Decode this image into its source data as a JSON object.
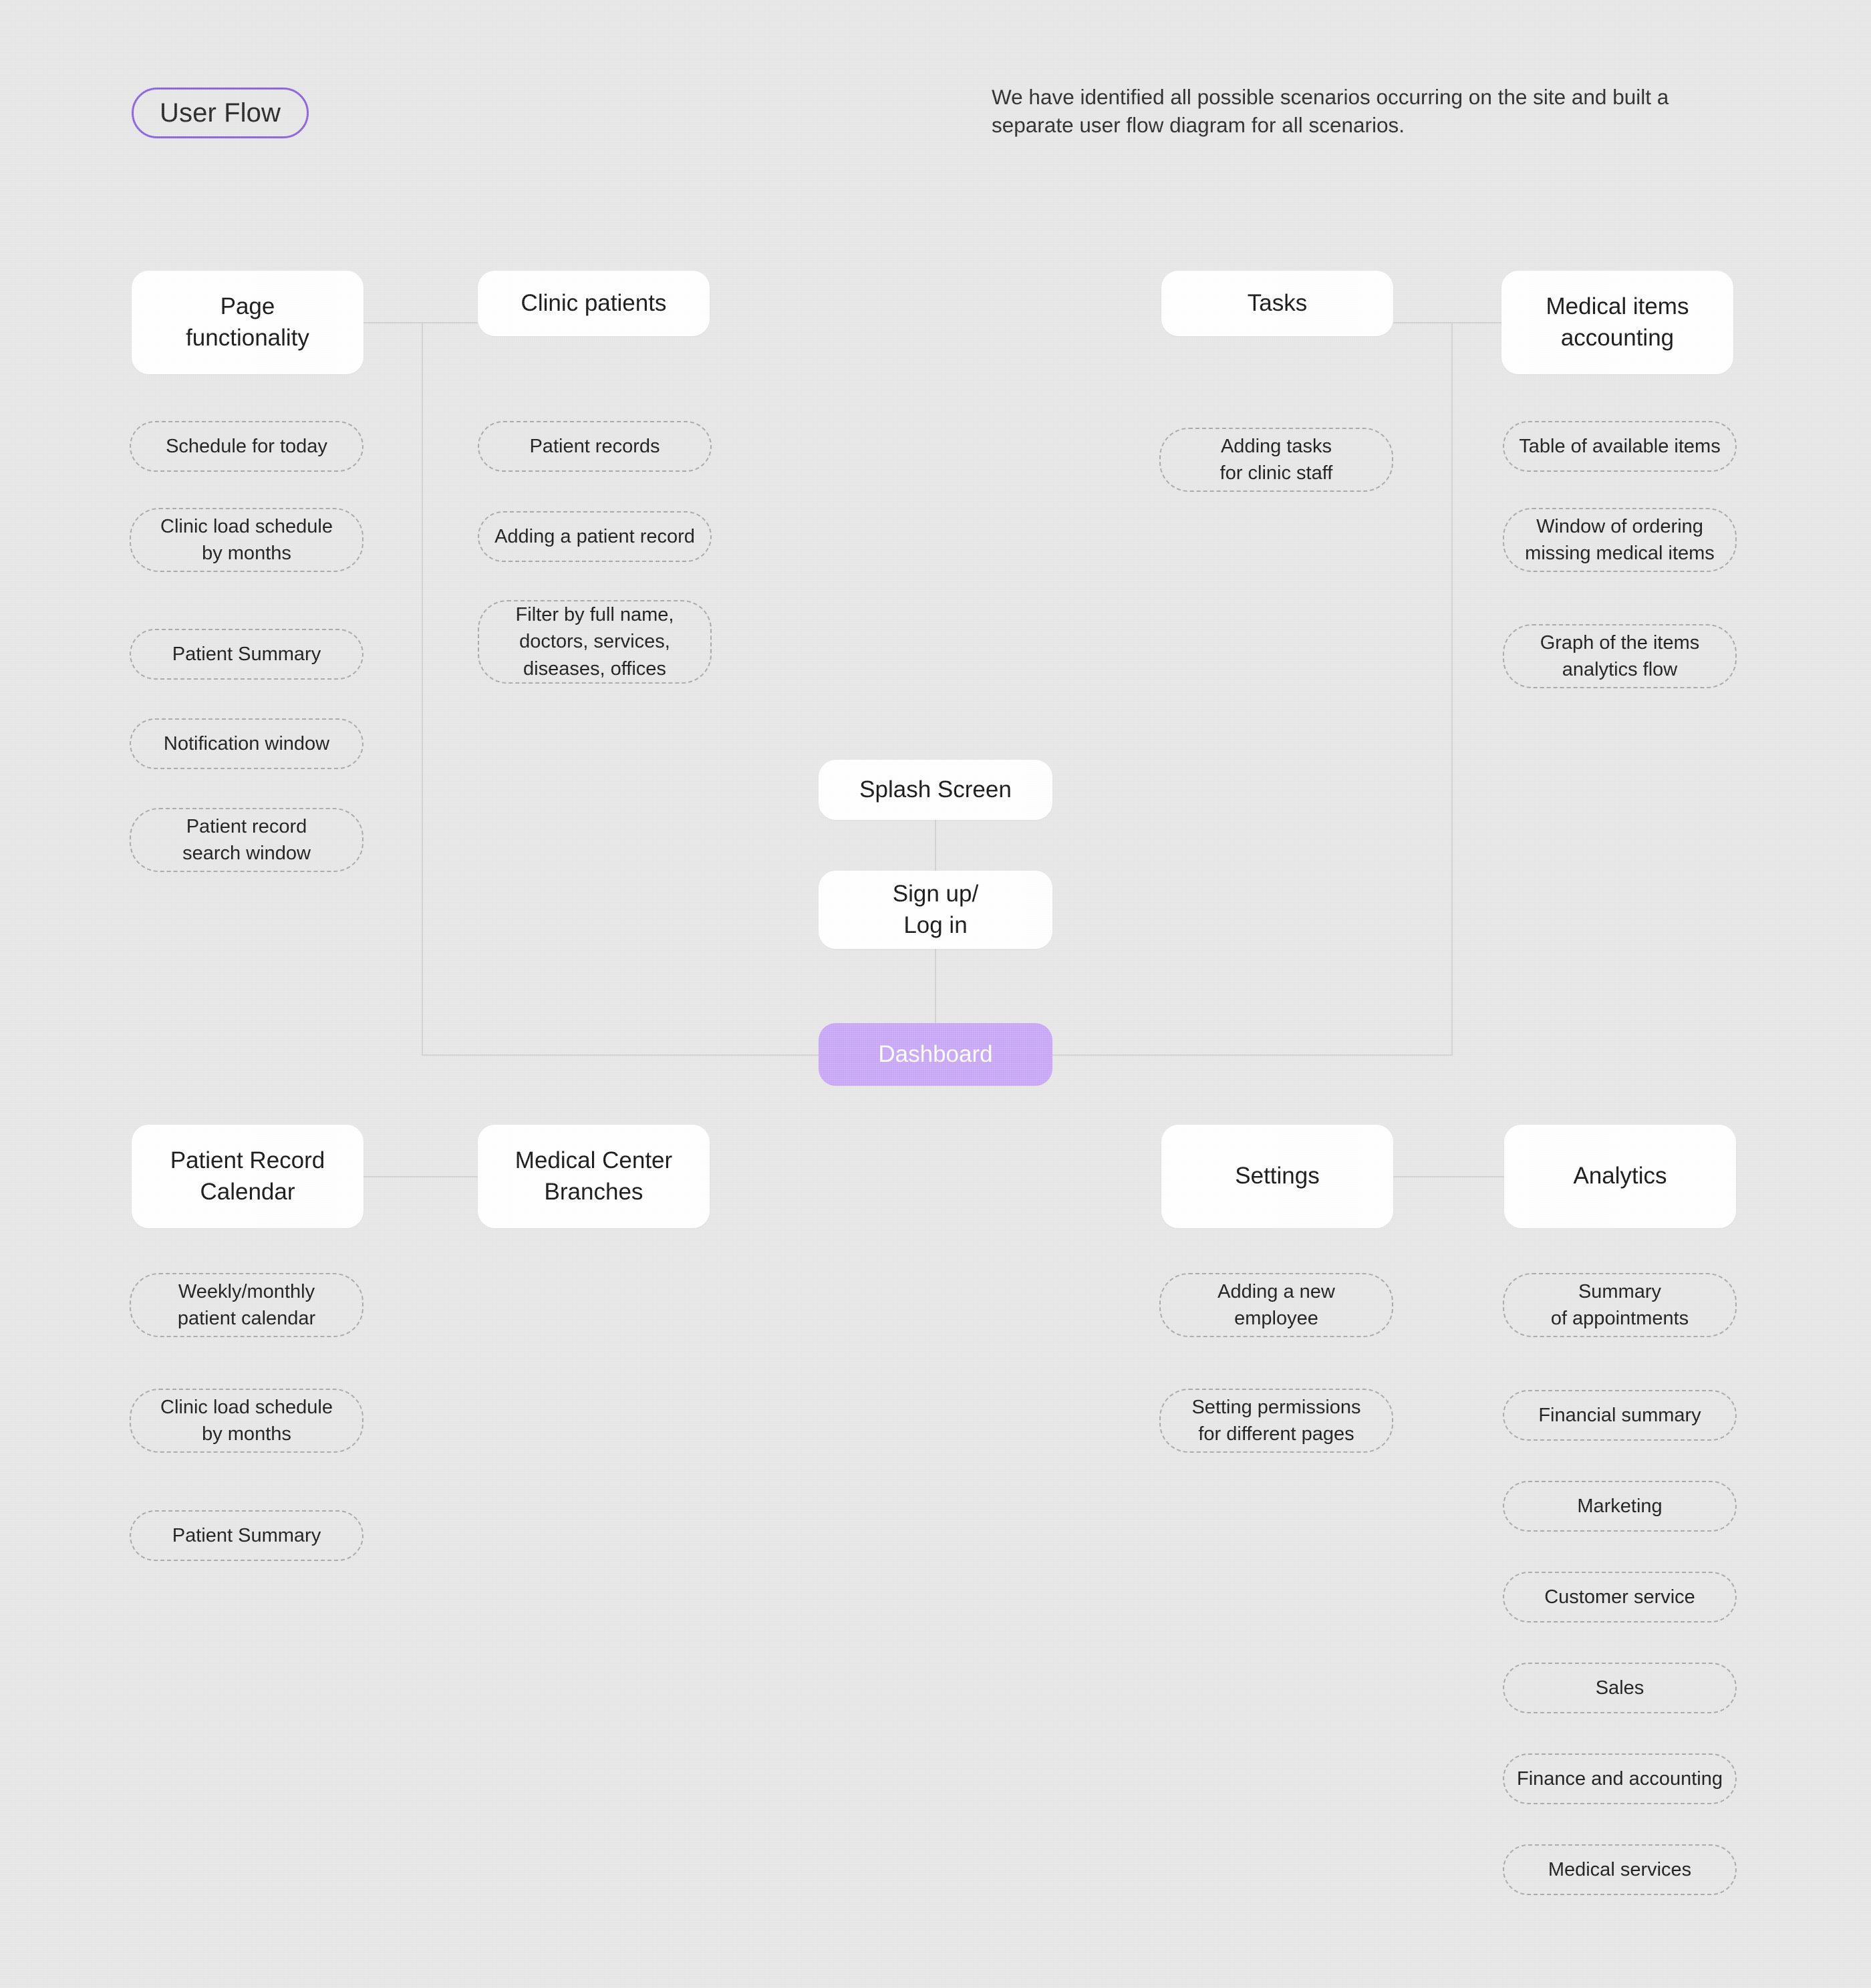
{
  "header": {
    "badge_label": "User Flow",
    "description": "We have identified all possible scenarios occurring on the site and built a separate user flow diagram for all scenarios."
  },
  "theme": {
    "background": "#e7e7e7",
    "card_background": "#ffffff",
    "accent": "#c9a8f7",
    "badge_border": "#8b62e0",
    "pill_border": "#a8a8a8",
    "connector": "#d2d2d2",
    "text": "#151515"
  },
  "center_flow": {
    "nodes": [
      {
        "label": "Splash Screen",
        "accent": false
      },
      {
        "label": "Sign up/\nLog in",
        "accent": false
      },
      {
        "label": "Dashboard",
        "accent": true
      }
    ]
  },
  "columns": [
    {
      "id": "page-functionality",
      "title": "Page\nfunctionality",
      "items": [
        "Schedule for today",
        "Clinic load schedule\nby months",
        "Patient Summary",
        "Notification window",
        "Patient record\nsearch window"
      ]
    },
    {
      "id": "clinic-patients",
      "title": "Clinic patients",
      "items": [
        "Patient records",
        "Adding a patient record",
        "Filter by full name,\ndoctors, services,\ndiseases, offices"
      ]
    },
    {
      "id": "tasks",
      "title": "Tasks",
      "items": [
        "Adding tasks\nfor clinic staff"
      ]
    },
    {
      "id": "medical-items-accounting",
      "title": "Medical items\naccounting",
      "items": [
        "Table of available items",
        "Window of ordering\nmissing medical items",
        "Graph of the items\nanalytics flow"
      ]
    },
    {
      "id": "patient-record-calendar",
      "title": "Patient Record\nCalendar",
      "items": [
        "Weekly/monthly\npatient calendar",
        "Clinic load schedule\nby months",
        "Patient Summary"
      ]
    },
    {
      "id": "medical-center-branches",
      "title": "Medical Center\nBranches",
      "items": []
    },
    {
      "id": "settings",
      "title": "Settings",
      "items": [
        "Adding a new\nemployee",
        "Setting permissions\nfor different pages"
      ]
    },
    {
      "id": "analytics",
      "title": "Analytics",
      "items": [
        "Summary\nof appointments",
        "Financial summary",
        "Marketing",
        "Customer service",
        "Sales",
        "Finance and accounting",
        "Medical services"
      ]
    }
  ]
}
